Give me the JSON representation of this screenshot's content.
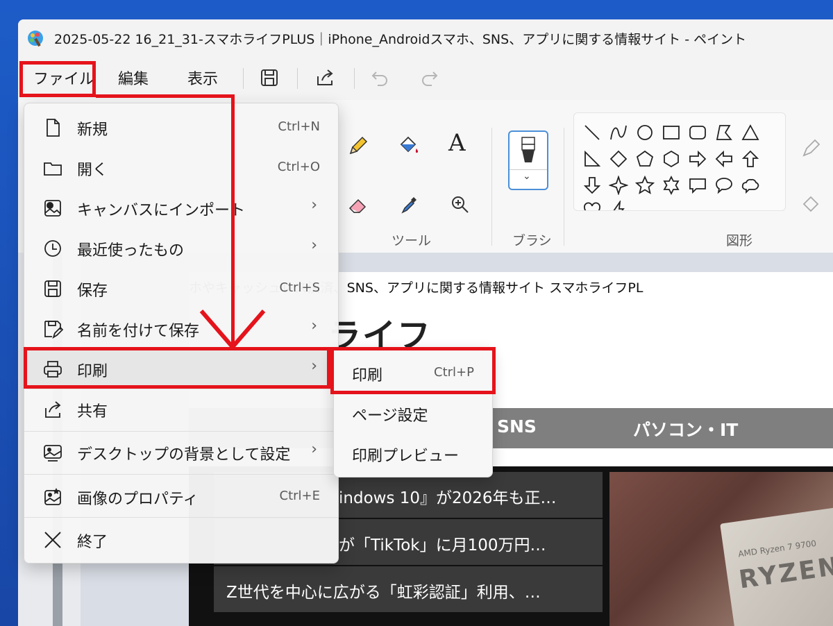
{
  "window": {
    "title": "2025-05-22 16_21_31-スマホライフPLUS｜iPhone_Androidスマホ、SNS、アプリに関する情報サイト - ペイント"
  },
  "menubar": {
    "items": [
      {
        "label": "ファイル"
      },
      {
        "label": "編集"
      },
      {
        "label": "表示"
      }
    ]
  },
  "ribbon": {
    "tools_label": "ツール",
    "brush_label": "ブラシ",
    "shapes_label": "図形"
  },
  "file_menu": {
    "items": [
      {
        "label": "新規",
        "shortcut": "Ctrl+N",
        "icon": "new-file-icon"
      },
      {
        "label": "開く",
        "shortcut": "Ctrl+O",
        "icon": "folder-icon"
      },
      {
        "label": "キャンバスにインポート",
        "shortcut": "",
        "icon": "import-icon",
        "submenu": true
      },
      {
        "label": "最近使ったもの",
        "shortcut": "",
        "icon": "clock-icon",
        "submenu": true
      },
      {
        "label": "保存",
        "shortcut": "Ctrl+S",
        "icon": "save-icon"
      },
      {
        "label": "名前を付けて保存",
        "shortcut": "",
        "icon": "save-as-icon",
        "submenu": true
      },
      {
        "label": "印刷",
        "shortcut": "",
        "icon": "printer-icon",
        "submenu": true
      },
      {
        "label": "共有",
        "shortcut": "",
        "icon": "share-icon"
      },
      {
        "label": "デスクトップの背景として設定",
        "shortcut": "",
        "icon": "desktop-icon",
        "submenu": true
      },
      {
        "label": "画像のプロパティ",
        "shortcut": "Ctrl+E",
        "icon": "properties-icon"
      },
      {
        "label": "終了",
        "shortcut": "",
        "icon": "close-icon"
      }
    ],
    "chevron": "›"
  },
  "print_submenu": {
    "items": [
      {
        "label": "印刷",
        "shortcut": "Ctrl+P"
      },
      {
        "label": "ページ設定",
        "shortcut": ""
      },
      {
        "label": "印刷プレビュー",
        "shortcut": ""
      }
    ]
  },
  "canvas_image": {
    "top_text": "ホやキャッシュレス決済、SNS、アプリに関する情報サイト スマホライフPL",
    "logo_text": "ライフ",
    "nav": [
      "SNS",
      "パソコン・IT"
    ],
    "news": [
      "indows 10』が2026年も正…",
      "が「TikTok」に月100万円…",
      "Z世代を中心に広がる「虹彩認証」利用、…"
    ],
    "photo_brand": "RYZEN",
    "photo_small": "AMD Ryzen 7 9700"
  },
  "colors": {
    "annotation": "#e5131b",
    "desktop": "#1b4fb0"
  }
}
